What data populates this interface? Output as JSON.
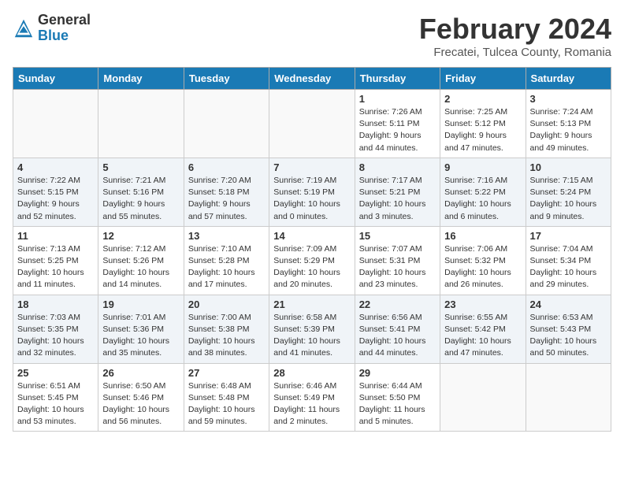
{
  "header": {
    "logo_general": "General",
    "logo_blue": "Blue",
    "month_title": "February 2024",
    "subtitle": "Frecatei, Tulcea County, Romania"
  },
  "days_of_week": [
    "Sunday",
    "Monday",
    "Tuesday",
    "Wednesday",
    "Thursday",
    "Friday",
    "Saturday"
  ],
  "weeks": [
    [
      {
        "day": "",
        "info": ""
      },
      {
        "day": "",
        "info": ""
      },
      {
        "day": "",
        "info": ""
      },
      {
        "day": "",
        "info": ""
      },
      {
        "day": "1",
        "info": "Sunrise: 7:26 AM\nSunset: 5:11 PM\nDaylight: 9 hours\nand 44 minutes."
      },
      {
        "day": "2",
        "info": "Sunrise: 7:25 AM\nSunset: 5:12 PM\nDaylight: 9 hours\nand 47 minutes."
      },
      {
        "day": "3",
        "info": "Sunrise: 7:24 AM\nSunset: 5:13 PM\nDaylight: 9 hours\nand 49 minutes."
      }
    ],
    [
      {
        "day": "4",
        "info": "Sunrise: 7:22 AM\nSunset: 5:15 PM\nDaylight: 9 hours\nand 52 minutes."
      },
      {
        "day": "5",
        "info": "Sunrise: 7:21 AM\nSunset: 5:16 PM\nDaylight: 9 hours\nand 55 minutes."
      },
      {
        "day": "6",
        "info": "Sunrise: 7:20 AM\nSunset: 5:18 PM\nDaylight: 9 hours\nand 57 minutes."
      },
      {
        "day": "7",
        "info": "Sunrise: 7:19 AM\nSunset: 5:19 PM\nDaylight: 10 hours\nand 0 minutes."
      },
      {
        "day": "8",
        "info": "Sunrise: 7:17 AM\nSunset: 5:21 PM\nDaylight: 10 hours\nand 3 minutes."
      },
      {
        "day": "9",
        "info": "Sunrise: 7:16 AM\nSunset: 5:22 PM\nDaylight: 10 hours\nand 6 minutes."
      },
      {
        "day": "10",
        "info": "Sunrise: 7:15 AM\nSunset: 5:24 PM\nDaylight: 10 hours\nand 9 minutes."
      }
    ],
    [
      {
        "day": "11",
        "info": "Sunrise: 7:13 AM\nSunset: 5:25 PM\nDaylight: 10 hours\nand 11 minutes."
      },
      {
        "day": "12",
        "info": "Sunrise: 7:12 AM\nSunset: 5:26 PM\nDaylight: 10 hours\nand 14 minutes."
      },
      {
        "day": "13",
        "info": "Sunrise: 7:10 AM\nSunset: 5:28 PM\nDaylight: 10 hours\nand 17 minutes."
      },
      {
        "day": "14",
        "info": "Sunrise: 7:09 AM\nSunset: 5:29 PM\nDaylight: 10 hours\nand 20 minutes."
      },
      {
        "day": "15",
        "info": "Sunrise: 7:07 AM\nSunset: 5:31 PM\nDaylight: 10 hours\nand 23 minutes."
      },
      {
        "day": "16",
        "info": "Sunrise: 7:06 AM\nSunset: 5:32 PM\nDaylight: 10 hours\nand 26 minutes."
      },
      {
        "day": "17",
        "info": "Sunrise: 7:04 AM\nSunset: 5:34 PM\nDaylight: 10 hours\nand 29 minutes."
      }
    ],
    [
      {
        "day": "18",
        "info": "Sunrise: 7:03 AM\nSunset: 5:35 PM\nDaylight: 10 hours\nand 32 minutes."
      },
      {
        "day": "19",
        "info": "Sunrise: 7:01 AM\nSunset: 5:36 PM\nDaylight: 10 hours\nand 35 minutes."
      },
      {
        "day": "20",
        "info": "Sunrise: 7:00 AM\nSunset: 5:38 PM\nDaylight: 10 hours\nand 38 minutes."
      },
      {
        "day": "21",
        "info": "Sunrise: 6:58 AM\nSunset: 5:39 PM\nDaylight: 10 hours\nand 41 minutes."
      },
      {
        "day": "22",
        "info": "Sunrise: 6:56 AM\nSunset: 5:41 PM\nDaylight: 10 hours\nand 44 minutes."
      },
      {
        "day": "23",
        "info": "Sunrise: 6:55 AM\nSunset: 5:42 PM\nDaylight: 10 hours\nand 47 minutes."
      },
      {
        "day": "24",
        "info": "Sunrise: 6:53 AM\nSunset: 5:43 PM\nDaylight: 10 hours\nand 50 minutes."
      }
    ],
    [
      {
        "day": "25",
        "info": "Sunrise: 6:51 AM\nSunset: 5:45 PM\nDaylight: 10 hours\nand 53 minutes."
      },
      {
        "day": "26",
        "info": "Sunrise: 6:50 AM\nSunset: 5:46 PM\nDaylight: 10 hours\nand 56 minutes."
      },
      {
        "day": "27",
        "info": "Sunrise: 6:48 AM\nSunset: 5:48 PM\nDaylight: 10 hours\nand 59 minutes."
      },
      {
        "day": "28",
        "info": "Sunrise: 6:46 AM\nSunset: 5:49 PM\nDaylight: 11 hours\nand 2 minutes."
      },
      {
        "day": "29",
        "info": "Sunrise: 6:44 AM\nSunset: 5:50 PM\nDaylight: 11 hours\nand 5 minutes."
      },
      {
        "day": "",
        "info": ""
      },
      {
        "day": "",
        "info": ""
      }
    ]
  ]
}
